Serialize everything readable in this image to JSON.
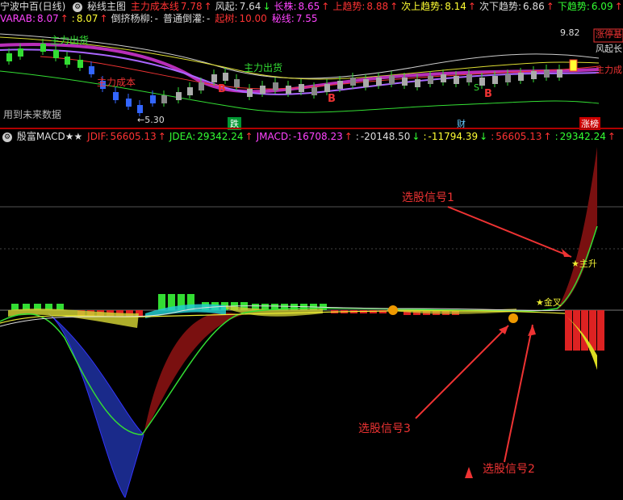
{
  "header": {
    "stock_title": "宁波中百(日线)",
    "main_chart_name": "秘线主图",
    "items": [
      {
        "label": "主力成本线",
        "value": "7.78",
        "arrow": "↑",
        "label_color": "#ff3333",
        "value_color": "#ff3333"
      },
      {
        "label": "风起:",
        "value": "7.64",
        "arrow": "↓",
        "label_color": "#dddddd",
        "value_color": "#dddddd"
      },
      {
        "label": "长株:",
        "value": "8.65",
        "arrow": "↑",
        "label_color": "#ff44ff",
        "value_color": "#ff44ff"
      },
      {
        "label": "上趋势:",
        "value": "8.88",
        "arrow": "↑",
        "label_color": "#ff3333",
        "value_color": "#ff3333"
      },
      {
        "label": "次上趋势:",
        "value": "8.14",
        "arrow": "↑",
        "label_color": "#ffff33",
        "value_color": "#ffff33"
      },
      {
        "label": "次下趋势:",
        "value": "6.86",
        "arrow": "↑",
        "label_color": "#dddddd",
        "value_color": "#dddddd"
      },
      {
        "label": "下趋势:",
        "value": "6.09",
        "arrow": "↑",
        "label_color": "#33ff33",
        "value_color": "#33ff33"
      }
    ]
  },
  "header2": {
    "items": [
      {
        "label": "VARAB:",
        "value": "8.07",
        "arrow": "↑",
        "color": "#ff44ff"
      },
      {
        "label": ":",
        "value": "8.07",
        "arrow": "↑",
        "color": "#ffff33"
      },
      {
        "label": "倒挤杨柳:",
        "value": "-",
        "arrow": "",
        "color": "#dddddd"
      },
      {
        "label": "普通倒灌:",
        "value": "-",
        "arrow": "",
        "color": "#dddddd"
      },
      {
        "label": "起树:",
        "value": "10.00",
        "arrow": "",
        "color": "#ff3333"
      },
      {
        "label": "秘线:",
        "value": "7.55",
        "arrow": "",
        "color": "#ff44ff"
      }
    ]
  },
  "main_chart": {
    "price_high_label": "9.82",
    "price_low_label": "←5.30",
    "future_data_note": "用到未来数据",
    "labels": {
      "zhuli_chuhuo_1": "主力出货",
      "zhuli_chuhuo_2": "主力出货",
      "zhuli_chengben": "主力成本",
      "zhuli_cheng_right": "主力成",
      "zhangting_ji": "涨停基",
      "fengqi": "风起长",
      "b1": "B",
      "b2": "B",
      "b3": "B",
      "die": "跌",
      "cai": "财",
      "zhangbang": "涨榜",
      "s1": "S"
    }
  },
  "macd_header": {
    "name": "殷富MACD★★",
    "items": [
      {
        "label": "JDIF:",
        "value": "56605.13",
        "arrow": "↑",
        "color": "#ff3333"
      },
      {
        "label": "JDEA:",
        "value": "29342.24",
        "arrow": "↑",
        "color": "#33ff33"
      },
      {
        "label": "JMACD:",
        "value": "-16708.23",
        "arrow": "↑",
        "color": "#ff44ff"
      },
      {
        "label": ":",
        "value": "-20148.50",
        "arrow": "↓",
        "color": "#dddddd"
      },
      {
        "label": ":",
        "value": "-11794.39",
        "arrow": "↓",
        "color": "#ffff33"
      },
      {
        "label": ":",
        "value": "56605.13",
        "arrow": "↑",
        "color": "#ff3333"
      },
      {
        "label": ":",
        "value": "29342.24",
        "arrow": "↑",
        "color": "#33ff33"
      }
    ]
  },
  "macd_chart": {
    "zhusheng": "★主升",
    "jin": "★金叉"
  },
  "annotations": {
    "signal1": "选股信号1",
    "signal2": "选股信号2",
    "signal3": "选股信号3"
  },
  "colors": {
    "background": "#000000",
    "divider": "#b00000",
    "up": "#ff3333",
    "down": "#33ff33",
    "magenta": "#ff44ff",
    "yellow": "#ffff33",
    "annotation": "#e33333"
  }
}
